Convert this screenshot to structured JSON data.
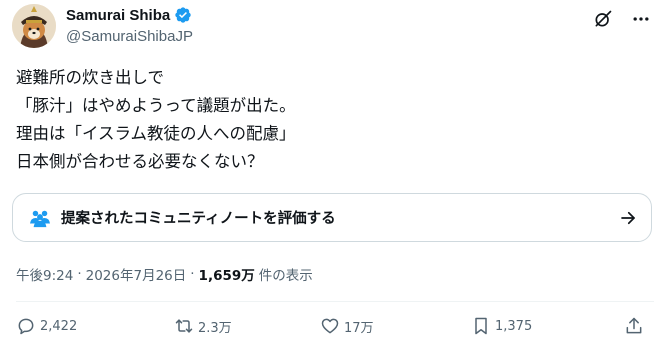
{
  "user": {
    "display_name": "Samurai Shiba",
    "handle": "@SamuraiShibaJP",
    "verified": true,
    "avatar_icon": "shiba-samurai-avatar"
  },
  "header_icons": [
    "grok-icon",
    "more-icon"
  ],
  "tweet": {
    "text": "避難所の炊き出しで\n「豚汁」はやめようって議題が出た。\n理由は「イスラム教徒の人への配慮」\n日本側が合わせる必要なくない？"
  },
  "community_note": {
    "label": "提案されたコミュニティノートを評価する"
  },
  "meta": {
    "time": "午後9:24",
    "sep1": "·",
    "date": "2026年7月26日",
    "sep2": "·",
    "views": "1,659万",
    "views_label": "件の表示"
  },
  "actions": {
    "replies": "2,422",
    "reposts": "2.3万",
    "likes": "17万",
    "bookmarks": "1,375"
  },
  "colors": {
    "text": "#0f1419",
    "muted": "#536471",
    "verified": "#1d9bf0",
    "border": "#cfd9de"
  }
}
